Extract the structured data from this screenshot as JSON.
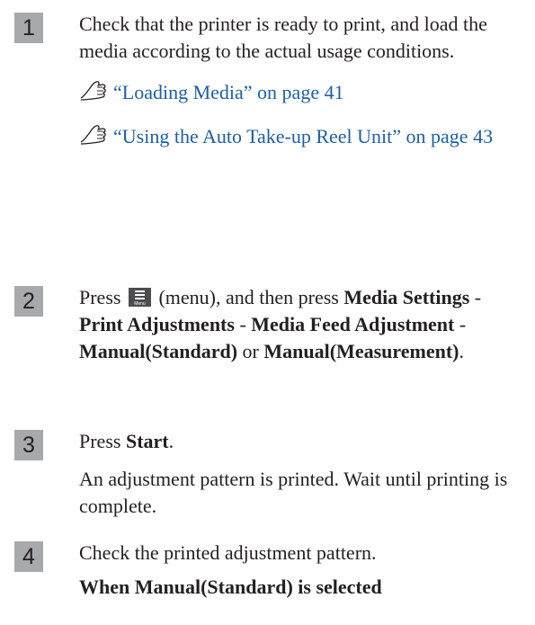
{
  "steps": [
    {
      "number": "1",
      "text": "Check that the printer is ready to print, and load the media according to the actual usage conditions.",
      "links": [
        "“Loading Media” on page 41",
        "“Using the Auto Take-up Reel Unit” on page 43"
      ]
    },
    {
      "number": "2",
      "press": "Press",
      "menu_icon_label": "Menu",
      "after_icon": "(menu), and then press",
      "path_1": "Media Settings",
      "sep": "-",
      "path_2": "Print Adjustments",
      "path_3": "Media Feed Adjustment",
      "path_4": "Manual(Standard)",
      "or": "or",
      "path_5": "Manual(Measurement)",
      "end": "."
    },
    {
      "number": "3",
      "press": "Press",
      "button": "Start",
      "end": ".",
      "note": "An adjustment pattern is printed. Wait until printing is complete."
    },
    {
      "number": "4",
      "text": "Check the printed adjustment pattern.",
      "subheading": "When Manual(Standard) is selected"
    }
  ],
  "colors": {
    "link": "#1b5fa8",
    "step_badge": "#a7a9ac",
    "text": "#231f20"
  },
  "icons": {
    "reference": "pointing-hand-icon",
    "menu": "menu-icon"
  }
}
